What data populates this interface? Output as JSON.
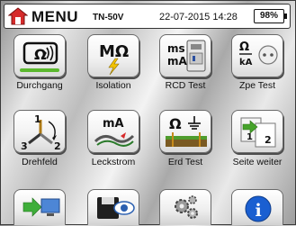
{
  "header": {
    "title": "MENU",
    "model": "TN-50V",
    "datetime": "22-07-2015 14:28",
    "battery": "98%"
  },
  "tiles": [
    {
      "label": "Durchgang",
      "icon": "continuity-icon",
      "symbol": "Ω"
    },
    {
      "label": "Isolation",
      "icon": "insulation-icon",
      "symbol": "MΩ"
    },
    {
      "label": "RCD Test",
      "icon": "rcd-test-icon",
      "symbol": "ms",
      "symbol2": "mA"
    },
    {
      "label": "Zpe Test",
      "icon": "zpe-test-icon",
      "symbol": "Ω",
      "symbol2": "kA"
    },
    {
      "label": "Drehfeld",
      "icon": "phase-rotation-icon",
      "n1": "1",
      "n2": "2",
      "n3": "3"
    },
    {
      "label": "Leckstrom",
      "icon": "leakage-current-icon",
      "symbol": "mA"
    },
    {
      "label": "Erd Test",
      "icon": "earth-test-icon",
      "symbol": "Ω"
    },
    {
      "label": "Seite weiter",
      "icon": "next-page-icon",
      "n1": "1",
      "n2": "2"
    }
  ],
  "bottom": [
    {
      "icon": "data-transfer-icon"
    },
    {
      "icon": "memory-view-icon"
    },
    {
      "icon": "settings-gears-icon"
    },
    {
      "icon": "info-icon",
      "symbol": "i"
    }
  ],
  "colors": {
    "accent": "#5bb82e",
    "info_blue": "#1a5fd1",
    "home_red": "#d62b2b"
  }
}
